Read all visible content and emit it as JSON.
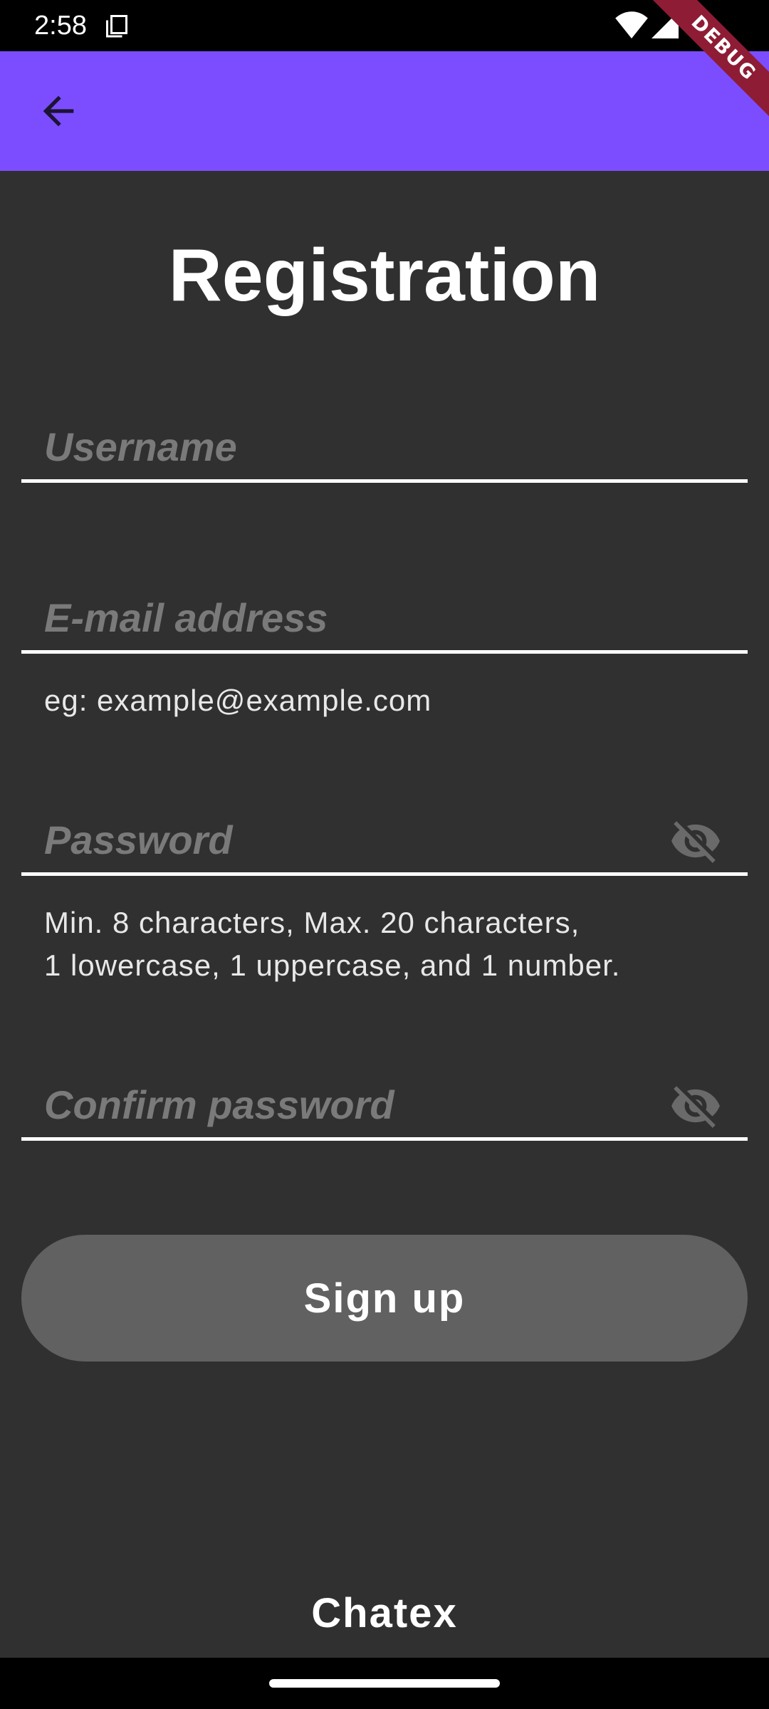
{
  "status_bar": {
    "time": "2:58",
    "icons": [
      "copy-icon",
      "wifi-icon",
      "cellular-signal-icon"
    ]
  },
  "app_bar": {
    "back_icon": "arrow-back-icon",
    "color": "#7c4dff"
  },
  "debug_banner": "DEBUG",
  "page": {
    "title": "Registration"
  },
  "form": {
    "username": {
      "placeholder": "Username",
      "value": ""
    },
    "email": {
      "placeholder": "E-mail address",
      "value": "",
      "helper": "eg: example@example.com"
    },
    "password": {
      "placeholder": "Password",
      "value": "",
      "helper_line1": "Min. 8 characters, Max. 20 characters,",
      "helper_line2": "1 lowercase, 1 uppercase, and 1 number.",
      "toggle_icon": "visibility-off-icon"
    },
    "confirm_password": {
      "placeholder": "Confirm password",
      "value": "",
      "toggle_icon": "visibility-off-icon"
    },
    "submit_label": "Sign up"
  },
  "footer": {
    "brand": "Chatex"
  },
  "colors": {
    "background": "#303030",
    "accent": "#7c4dff",
    "button": "#616161",
    "placeholder": "#7a7a7a",
    "debug_ribbon": "#8e1c35"
  }
}
